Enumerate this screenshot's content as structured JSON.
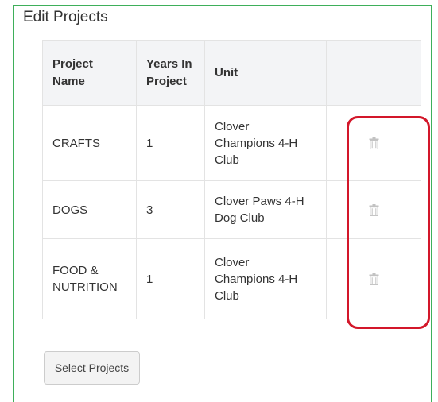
{
  "section": {
    "title": "Edit Projects"
  },
  "table": {
    "headers": {
      "project_name": "Project Name",
      "years_line1": "Years In",
      "years_line2": "Project",
      "unit": "Unit",
      "action": ""
    },
    "rows": [
      {
        "project_name": [
          "CRAFTS"
        ],
        "years": "1",
        "unit": [
          "Clover",
          "Champions 4-H",
          "Club"
        ],
        "action_icon": "trash-icon"
      },
      {
        "project_name": [
          "DOGS"
        ],
        "years": "3",
        "unit": [
          "Clover Paws 4-H",
          "Dog Club"
        ],
        "action_icon": "trash-icon"
      },
      {
        "project_name": [
          "FOOD &",
          "NUTRITION"
        ],
        "years": "1",
        "unit": [
          "Clover",
          "Champions 4-H",
          "Club"
        ],
        "action_icon": "trash-icon"
      }
    ]
  },
  "buttons": {
    "select_projects": "Select Projects"
  },
  "colors": {
    "frame_border": "#3eaf5a",
    "highlight": "#d3172a",
    "header_bg": "#f3f4f6",
    "icon": "#c2c2c2"
  }
}
